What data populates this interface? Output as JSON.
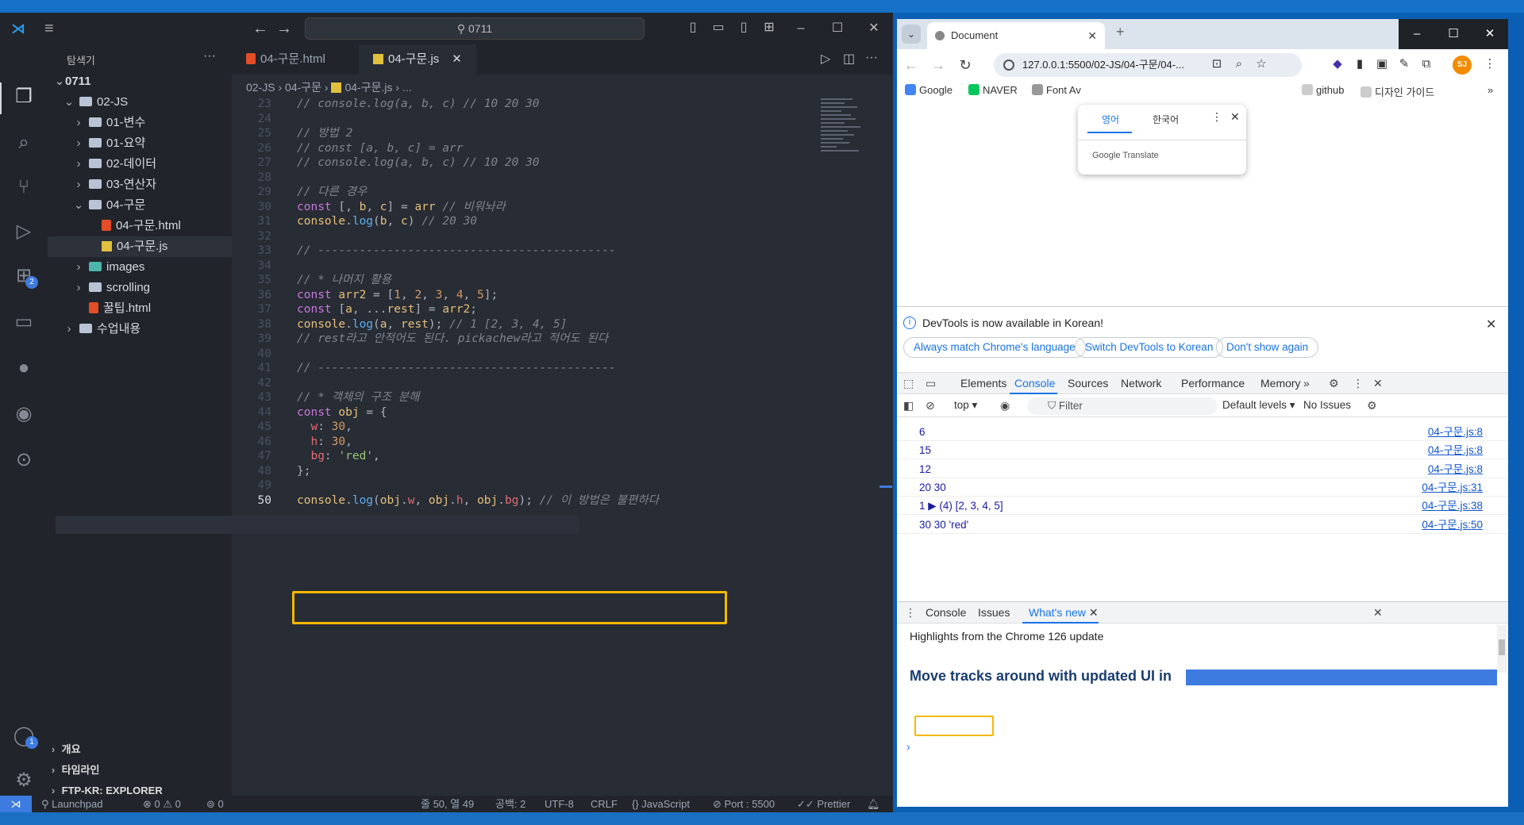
{
  "vscode": {
    "search_text": "0711",
    "explorer_title": "탐색기",
    "tree": [
      {
        "label": "0711",
        "level": 0,
        "kind": "root",
        "open": true
      },
      {
        "label": "02-JS",
        "level": 1,
        "kind": "folder",
        "open": true
      },
      {
        "label": "01-변수",
        "level": 2,
        "kind": "folder",
        "open": false
      },
      {
        "label": "01-요약",
        "level": 2,
        "kind": "folder",
        "open": false
      },
      {
        "label": "02-데이터",
        "level": 2,
        "kind": "folder",
        "open": false
      },
      {
        "label": "03-연산자",
        "level": 2,
        "kind": "folder",
        "open": false
      },
      {
        "label": "04-구문",
        "level": 2,
        "kind": "folder",
        "open": true
      },
      {
        "label": "04-구문.html",
        "level": 3,
        "kind": "html"
      },
      {
        "label": "04-구문.js",
        "level": 3,
        "kind": "js",
        "selected": true
      },
      {
        "label": "images",
        "level": 2,
        "kind": "imgfolder",
        "open": false
      },
      {
        "label": "scrolling",
        "level": 2,
        "kind": "folder",
        "open": false
      },
      {
        "label": "꿀팁.html",
        "level": 2,
        "kind": "html"
      },
      {
        "label": "수업내용",
        "level": 1,
        "kind": "folder",
        "open": false
      }
    ],
    "sections": [
      "개요",
      "타임라인",
      "FTP-KR: EXPLORER"
    ],
    "tabs": [
      {
        "label": "04-구문.html",
        "active": false
      },
      {
        "label": "04-구문.js",
        "active": true
      }
    ],
    "breadcrumb": {
      "folder": "02-JS",
      "sub": "04-구문",
      "file": "04-구문.js",
      "tail": "..."
    },
    "badges": {
      "extensions": "2",
      "accounts": "1"
    },
    "code_lines": [
      {
        "n": "23",
        "t": [
          [
            "c",
            "// console.log(a, b, c) // 10 20 30"
          ]
        ]
      },
      {
        "n": "24",
        "t": []
      },
      {
        "n": "25",
        "t": [
          [
            "c",
            "// 방법 2"
          ]
        ]
      },
      {
        "n": "26",
        "t": [
          [
            "c",
            "// const [a, b, c] = arr"
          ]
        ]
      },
      {
        "n": "27",
        "t": [
          [
            "c",
            "// console.log(a, b, c) // 10 20 30"
          ]
        ]
      },
      {
        "n": "28",
        "t": []
      },
      {
        "n": "29",
        "t": [
          [
            "c",
            "// 다른 경우"
          ]
        ]
      },
      {
        "n": "30",
        "t": [
          [
            "k",
            "const"
          ],
          [
            "p",
            " [, "
          ],
          [
            "v",
            "b"
          ],
          [
            "p",
            ", "
          ],
          [
            "v",
            "c"
          ],
          [
            "p",
            "] = "
          ],
          [
            "v",
            "arr"
          ],
          [
            "c",
            " // 비워놔라"
          ]
        ]
      },
      {
        "n": "31",
        "t": [
          [
            "v",
            "console"
          ],
          [
            "p",
            "."
          ],
          [
            "f",
            "log"
          ],
          [
            "p",
            "("
          ],
          [
            "v",
            "b"
          ],
          [
            "p",
            ", "
          ],
          [
            "v",
            "c"
          ],
          [
            "p",
            ") "
          ],
          [
            "c",
            "// 20 30"
          ]
        ]
      },
      {
        "n": "32",
        "t": []
      },
      {
        "n": "33",
        "t": [
          [
            "c",
            "// -------------------------------------------"
          ]
        ]
      },
      {
        "n": "34",
        "t": []
      },
      {
        "n": "35",
        "t": [
          [
            "c",
            "// * 나머지 활용"
          ]
        ]
      },
      {
        "n": "36",
        "t": [
          [
            "k",
            "const"
          ],
          [
            "p",
            " "
          ],
          [
            "v",
            "arr2"
          ],
          [
            "p",
            " = ["
          ],
          [
            "n",
            "1"
          ],
          [
            "p",
            ", "
          ],
          [
            "n",
            "2"
          ],
          [
            "p",
            ", "
          ],
          [
            "n",
            "3"
          ],
          [
            "p",
            ", "
          ],
          [
            "n",
            "4"
          ],
          [
            "p",
            ", "
          ],
          [
            "n",
            "5"
          ],
          [
            "p",
            "];"
          ]
        ]
      },
      {
        "n": "37",
        "t": [
          [
            "k",
            "const"
          ],
          [
            "p",
            " ["
          ],
          [
            "v",
            "a"
          ],
          [
            "p",
            ", ..."
          ],
          [
            "v",
            "rest"
          ],
          [
            "p",
            "] = "
          ],
          [
            "v",
            "arr2"
          ],
          [
            "p",
            ";"
          ]
        ]
      },
      {
        "n": "38",
        "t": [
          [
            "v",
            "console"
          ],
          [
            "p",
            "."
          ],
          [
            "f",
            "log"
          ],
          [
            "p",
            "("
          ],
          [
            "v",
            "a"
          ],
          [
            "p",
            ", "
          ],
          [
            "v",
            "rest"
          ],
          [
            "p",
            "); "
          ],
          [
            "c",
            "// 1 [2, 3, 4, 5]"
          ]
        ]
      },
      {
        "n": "39",
        "t": [
          [
            "c",
            "// rest라고 안적어도 된다. pickachew라고 적어도 된다"
          ]
        ]
      },
      {
        "n": "40",
        "t": []
      },
      {
        "n": "41",
        "t": [
          [
            "c",
            "// -------------------------------------------"
          ]
        ]
      },
      {
        "n": "42",
        "t": []
      },
      {
        "n": "43",
        "t": [
          [
            "c",
            "// * 객체의 구조 분해"
          ]
        ]
      },
      {
        "n": "44",
        "t": [
          [
            "k",
            "const"
          ],
          [
            "p",
            " "
          ],
          [
            "v",
            "obj"
          ],
          [
            "p",
            " = {"
          ]
        ]
      },
      {
        "n": "45",
        "t": [
          [
            "r",
            "  w"
          ],
          [
            "p",
            ": "
          ],
          [
            "n",
            "30"
          ],
          [
            "p",
            ","
          ]
        ]
      },
      {
        "n": "46",
        "t": [
          [
            "r",
            "  h"
          ],
          [
            "p",
            ": "
          ],
          [
            "n",
            "30"
          ],
          [
            "p",
            ","
          ]
        ]
      },
      {
        "n": "47",
        "t": [
          [
            "r",
            "  bg"
          ],
          [
            "p",
            ": "
          ],
          [
            "s",
            "'red'"
          ],
          [
            "p",
            ","
          ]
        ]
      },
      {
        "n": "48",
        "t": [
          [
            "p",
            "};"
          ]
        ]
      },
      {
        "n": "49",
        "t": []
      },
      {
        "n": "50",
        "t": [
          [
            "v",
            "console"
          ],
          [
            "p",
            "."
          ],
          [
            "f",
            "log"
          ],
          [
            "p",
            "("
          ],
          [
            "v",
            "obj"
          ],
          [
            "p",
            "."
          ],
          [
            "r",
            "w"
          ],
          [
            "p",
            ", "
          ],
          [
            "v",
            "obj"
          ],
          [
            "p",
            "."
          ],
          [
            "r",
            "h"
          ],
          [
            "p",
            ", "
          ],
          [
            "v",
            "obj"
          ],
          [
            "p",
            "."
          ],
          [
            "r",
            "bg"
          ],
          [
            "p",
            "); "
          ],
          [
            "c",
            "// 이 방법은 불편하다"
          ]
        ]
      }
    ],
    "status": {
      "launchpad": "Launchpad",
      "problems": "⊗ 0 ⚠ 0",
      "ports_count": "0",
      "cursor": "줄 50, 열 49",
      "spaces": "공백: 2",
      "encoding": "UTF-8",
      "eol": "CRLF",
      "language": "JavaScript",
      "port": "Port : 5500",
      "prettier": "Prettier"
    }
  },
  "chrome": {
    "tab_title": "Document",
    "url": "127.0.0.1:5500/02-JS/04-구문/04-...",
    "avatar": "SJ",
    "bookmarks": [
      "Google",
      "NAVER",
      "Font Av",
      "github",
      "디자인 가이드"
    ],
    "translate": {
      "lang_a": "영어",
      "lang_b": "한국어",
      "brand": "Google Translate"
    },
    "devtools": {
      "notice": "DevTools is now available in Korean!",
      "notice_buttons": [
        "Always match Chrome's language",
        "Switch DevTools to Korean",
        "Don't show again"
      ],
      "tabs": [
        "Elements",
        "Console",
        "Sources",
        "Network",
        "Performance",
        "Memory"
      ],
      "context": "top",
      "filter_placeholder": "Filter",
      "levels": "Default levels",
      "issues": "No Issues",
      "console_rows": [
        {
          "value": "6",
          "source": "04-구문.js:8"
        },
        {
          "value": "15",
          "source": "04-구문.js:8"
        },
        {
          "value": "12",
          "source": "04-구문.js:8"
        },
        {
          "value": "20 30",
          "source": "04-구문.js:31"
        },
        {
          "value": "1  ▶ (4) [2, 3, 4, 5]",
          "source": "04-구문.js:38"
        },
        {
          "value": "30 30 'red'",
          "source": "04-구문.js:50"
        }
      ],
      "drawer_tabs": [
        "Console",
        "Issues",
        "What's new"
      ],
      "drawer_text": "Highlights from the Chrome 126 update",
      "drawer_banner": "Move tracks around with updated UI in"
    }
  }
}
